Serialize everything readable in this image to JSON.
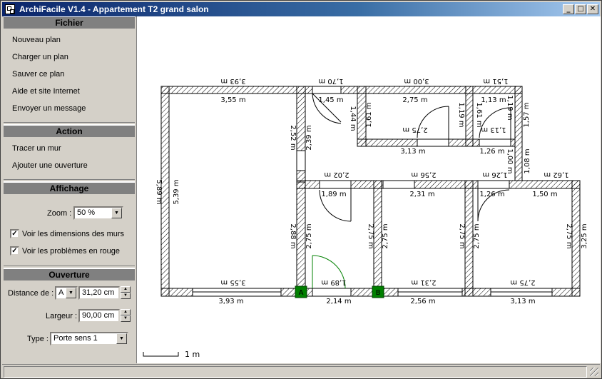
{
  "window": {
    "title": "ArchiFacile V1.4 - Appartement T2 grand salon"
  },
  "title_buttons": {
    "minimize": "_",
    "maximize": "□",
    "close": "✕"
  },
  "sections": {
    "fichier": {
      "title": "Fichier",
      "items": [
        "Nouveau plan",
        "Charger un plan",
        "Sauver ce plan",
        "Aide et site Internet",
        "Envoyer un message"
      ]
    },
    "action": {
      "title": "Action",
      "items": [
        "Tracer un mur",
        "Ajouter une ouverture"
      ]
    },
    "affichage": {
      "title": "Affichage",
      "zoom_label": "Zoom :",
      "zoom_value": "50 %",
      "check_dimensions": "Voir les dimensions des murs",
      "check_problems": "Voir les problèmes en rouge"
    },
    "ouverture": {
      "title": "Ouverture",
      "distance_label": "Distance de :",
      "distance_ref": "A",
      "distance_value": "31,20 cm",
      "largeur_label": "Largeur :",
      "largeur_value": "90,00 cm",
      "type_label": "Type :",
      "type_value": "Porte sens 1"
    }
  },
  "plan": {
    "scale_label": "1 m",
    "markers": {
      "a": "A",
      "b": "B"
    },
    "dimensions": {
      "top_3_93": "3,93 m",
      "top_3_55": "3,55 m",
      "top_1_70": "1,70 m",
      "top_1_45": "1,45 m",
      "top_3_00": "3,00 m",
      "top_2_75": "2,75 m",
      "top_1_51": "1,51 m",
      "top_1_13": "1,13 m",
      "left_5_89": "5,89 m",
      "left_5_39": "5,39 m",
      "v_2_52": "2,52 m",
      "v_2_39": "2,39 m",
      "v_1_44": "1,44 m",
      "v_1_61": "1,61 m",
      "v_1_19a": "1,19 m",
      "v_1_19b": "1,19 m",
      "v_1_61b": "1,61 m",
      "v_1_57": "1,57 m",
      "h_2_75b": "2,75 m",
      "h_1_13b": "1,13 m",
      "h_3_13": "3,13 m",
      "h_1_26": "1,26 m",
      "v_1_00": "1,00 m",
      "v_1_08": "1,08 m",
      "h_2_02": "2,02 m",
      "h_2_56": "2,56 m",
      "h_1_26b": "1,26 m",
      "h_1_62": "1,62 m",
      "h_1_89": "1,89 m",
      "h_2_31": "2,31 m",
      "h_1_26c": "1,26 m",
      "h_1_50": "1,50 m",
      "v_2_88": "2,88 m",
      "v_2_75a": "2,75 m",
      "v_2_75b": "2,75 m",
      "v_2_75c": "2,75 m",
      "v_2_75d": "2,75 m",
      "v_2_75e": "2,75 m",
      "v_2_75f": "2,75 m",
      "v_3_25": "3,25 m",
      "b_3_55": "3,55 m",
      "b_1_89": "1,89 m",
      "b_2_31": "2,31 m",
      "b_2_75": "2,75 m",
      "bot_3_93": "3,93 m",
      "bot_2_14": "2,14 m",
      "bot_2_56": "2,56 m",
      "bot_3_13": "3,13 m"
    }
  }
}
